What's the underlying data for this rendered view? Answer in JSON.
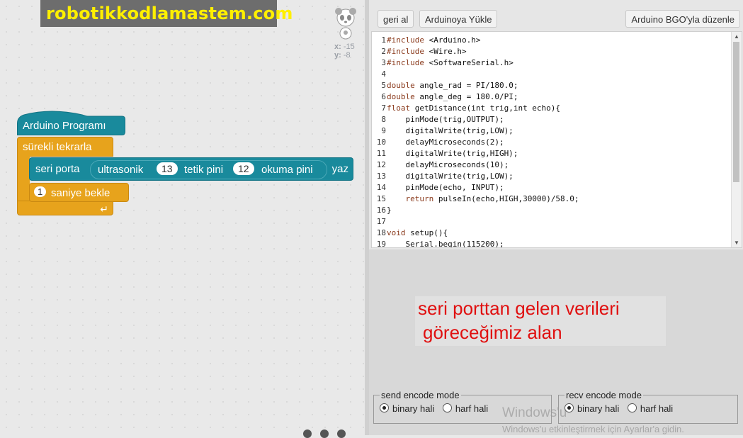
{
  "watermark": "robotikkodlamastem.com",
  "workspace": {
    "coord_x_label": "x:",
    "coord_x": "-15",
    "coord_y_label": "y:",
    "coord_y": "-8"
  },
  "blocks": {
    "hat": "Arduino Programı",
    "forever": "sürekli tekrarla",
    "serial_prefix": "seri porta",
    "ultrasonic": "ultrasonik",
    "trig_pin": "13",
    "trig_label": "tetik pini",
    "echo_pin": "12",
    "echo_label": "okuma pini",
    "serial_suffix": "yaz",
    "wait_value": "1",
    "wait_label": "saniye bekle"
  },
  "toolbar": {
    "back": "geri al",
    "upload": "Arduinoya Yükle",
    "edit": "Arduino BGO'yla düzenle"
  },
  "code_lines": [
    "#include <Arduino.h>",
    "#include <Wire.h>",
    "#include <SoftwareSerial.h>",
    "",
    "double angle_rad = PI/180.0;",
    "double angle_deg = 180.0/PI;",
    "float getDistance(int trig,int echo){",
    "    pinMode(trig,OUTPUT);",
    "    digitalWrite(trig,LOW);",
    "    delayMicroseconds(2);",
    "    digitalWrite(trig,HIGH);",
    "    delayMicroseconds(10);",
    "    digitalWrite(trig,LOW);",
    "    pinMode(echo, INPUT);",
    "    return pulseIn(echo,HIGH,30000)/58.0;",
    "}",
    "",
    "void setup(){",
    "    Serial.begin(115200);"
  ],
  "console": {
    "note_line1": "seri porttan gelen verileri",
    "note_line2": "göreceğimiz alan"
  },
  "send_mode": {
    "legend": "send encode mode",
    "option1": "binary hali",
    "option2": "harf hali",
    "selected": "binary hali"
  },
  "recv_mode": {
    "legend": "recv encode mode",
    "option1": "binary hali",
    "option2": "harf hali",
    "selected": "binary hali"
  },
  "windows_watermark": {
    "line1": "Windows'u",
    "line2": "Windows'u etkinleştirmek için Ayarlar'a gidin."
  },
  "colors": {
    "hat_block": "#198a9c",
    "control_block": "#e7a31c",
    "watermark_text": "#ffef00",
    "note_text": "#e01010"
  }
}
